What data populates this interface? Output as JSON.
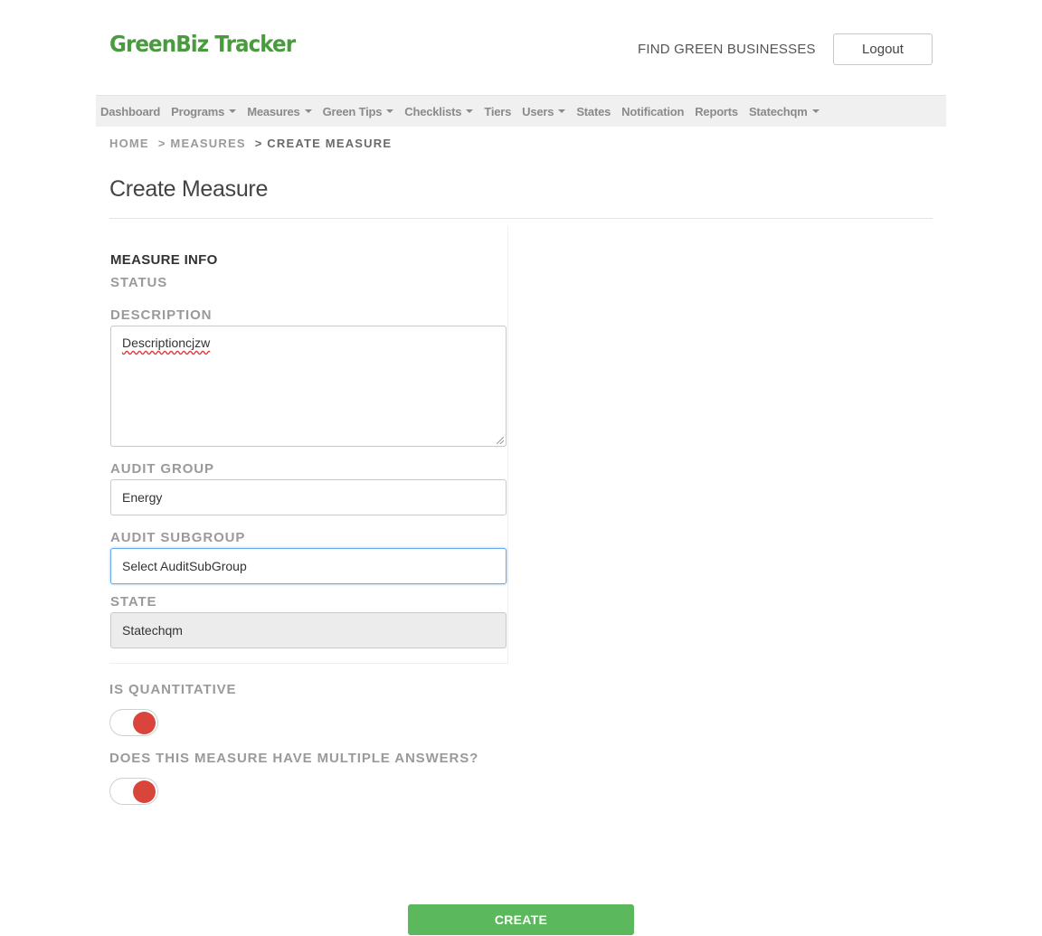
{
  "header": {
    "logo_text": "GreenBiz Tracker",
    "find_link": "FIND GREEN BUSINESSES",
    "logout_label": "Logout"
  },
  "nav": {
    "items": [
      {
        "label": "Dashboard",
        "dropdown": false
      },
      {
        "label": "Programs",
        "dropdown": true
      },
      {
        "label": "Measures",
        "dropdown": true
      },
      {
        "label": "Green Tips",
        "dropdown": true
      },
      {
        "label": "Checklists",
        "dropdown": true
      },
      {
        "label": "Tiers",
        "dropdown": false
      },
      {
        "label": "Users",
        "dropdown": true
      },
      {
        "label": "States",
        "dropdown": false
      },
      {
        "label": "Notification",
        "dropdown": false
      },
      {
        "label": "Reports",
        "dropdown": false
      },
      {
        "label": "Statechqm",
        "dropdown": true
      }
    ]
  },
  "breadcrumb": {
    "home": "HOME",
    "measures": "> MEASURES",
    "current": "> CREATE MEASURE"
  },
  "page_title": "Create Measure",
  "form": {
    "section_title": "MEASURE INFO",
    "status_label": "STATUS",
    "description_label": "DESCRIPTION",
    "description_value": "Descriptioncjzw",
    "audit_group_label": "AUDIT GROUP",
    "audit_group_value": "Energy",
    "audit_subgroup_label": "AUDIT SUBGROUP",
    "audit_subgroup_value": "Select AuditSubGroup",
    "state_label": "STATE",
    "state_value": "Statechqm",
    "is_quantitative_label": "IS QUANTITATIVE",
    "multiple_answers_label": "DOES THIS MEASURE HAVE MULTIPLE ANSWERS?",
    "toggle_color": "#d9453a"
  },
  "create_label": "CREATE",
  "colors": {
    "brand_green": "#4a9a3f",
    "button_green": "#5cb85c",
    "focus_blue": "#66a9e8"
  }
}
